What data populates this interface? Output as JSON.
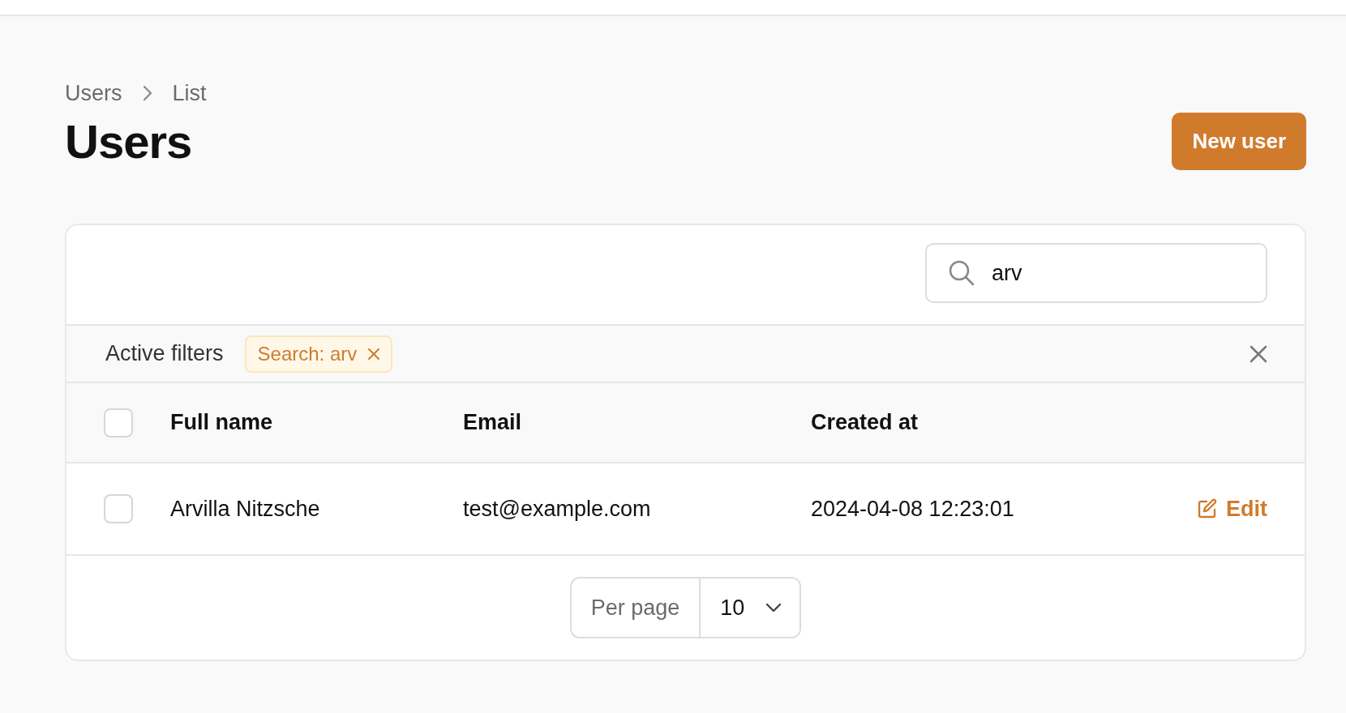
{
  "breadcrumb": [
    {
      "label": "Users"
    },
    {
      "label": "List"
    }
  ],
  "title": "Users",
  "new_button": "New user",
  "search": {
    "value": "arv"
  },
  "filters": {
    "label": "Active filters",
    "chips": [
      {
        "label": "Search: arv"
      }
    ]
  },
  "table": {
    "columns": [
      "Full name",
      "Email",
      "Created at"
    ],
    "select_all": {
      "checked": false
    },
    "rows": [
      {
        "checked": false,
        "cells": [
          "Arvilla Nitzsche",
          "test@example.com",
          "2024-04-08 12:23:01"
        ],
        "action": "Edit"
      }
    ]
  },
  "pagination": {
    "per_page_label": "Per page",
    "per_page": "10"
  }
}
